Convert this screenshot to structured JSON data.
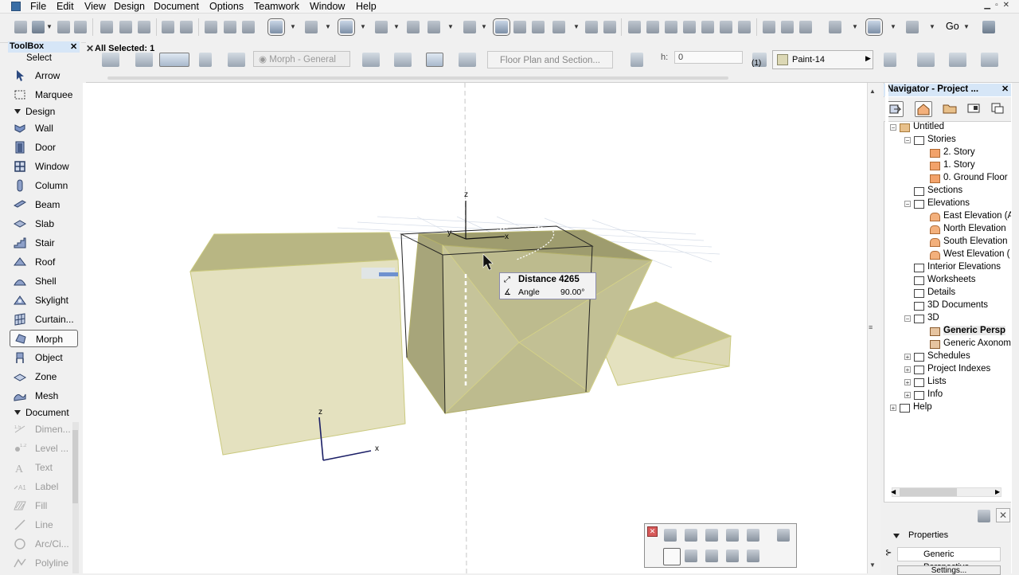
{
  "menubar": {
    "items": [
      "File",
      "Edit",
      "View",
      "Design",
      "Document",
      "Options",
      "Teamwork",
      "Window",
      "Help"
    ]
  },
  "toolbar": {
    "go_label": "Go"
  },
  "infobox": {
    "all_selected": "All Selected: 1",
    "morph_dropdown": "Morph - General",
    "floorplan_button": "Floor Plan and Section...",
    "height_label": "h:",
    "height_value": "0",
    "paint_label": "Paint-14",
    "paint_color": "#dcd8b5",
    "count_label": "(1)"
  },
  "toolbox": {
    "title": "ToolBox",
    "select_label": "Select",
    "select_tools": [
      {
        "label": "Arrow",
        "icon": "arrow-icon"
      },
      {
        "label": "Marquee",
        "icon": "marquee-icon"
      }
    ],
    "design_label": "Design",
    "design_tools": [
      {
        "label": "Wall",
        "icon": "wall-icon"
      },
      {
        "label": "Door",
        "icon": "door-icon"
      },
      {
        "label": "Window",
        "icon": "window-icon"
      },
      {
        "label": "Column",
        "icon": "column-icon"
      },
      {
        "label": "Beam",
        "icon": "beam-icon"
      },
      {
        "label": "Slab",
        "icon": "slab-icon"
      },
      {
        "label": "Stair",
        "icon": "stair-icon"
      },
      {
        "label": "Roof",
        "icon": "roof-icon"
      },
      {
        "label": "Shell",
        "icon": "shell-icon"
      },
      {
        "label": "Skylight",
        "icon": "skylight-icon"
      },
      {
        "label": "Curtain...",
        "icon": "curtain-wall-icon"
      },
      {
        "label": "Morph",
        "icon": "morph-icon",
        "selected": true
      },
      {
        "label": "Object",
        "icon": "object-icon"
      },
      {
        "label": "Zone",
        "icon": "zone-icon"
      },
      {
        "label": "Mesh",
        "icon": "mesh-icon"
      }
    ],
    "document_label": "Document",
    "document_tools": [
      {
        "label": "Dimen...",
        "icon": "dimension-icon"
      },
      {
        "label": "Level ...",
        "icon": "level-dimension-icon"
      },
      {
        "label": "Text",
        "icon": "text-icon"
      },
      {
        "label": "Label",
        "icon": "label-icon"
      },
      {
        "label": "Fill",
        "icon": "fill-icon"
      },
      {
        "label": "Line",
        "icon": "line-icon"
      },
      {
        "label": "Arc/Ci...",
        "icon": "arc-circle-icon"
      },
      {
        "label": "Polyline",
        "icon": "polyline-icon"
      }
    ]
  },
  "viewport": {
    "tooltip": {
      "distance_label": "Distance",
      "distance_value": "4265",
      "angle_label": "Angle",
      "angle_value": "90.00°"
    },
    "axes": {
      "z": "z",
      "y": "y",
      "x": "x"
    },
    "morph_color": "#d8d5a8"
  },
  "navigator": {
    "title": "Navigator - Project ...",
    "tree": [
      {
        "label": "Untitled",
        "level": 0,
        "icon": "folder"
      },
      {
        "label": "Stories",
        "level": 1,
        "icon": "doc"
      },
      {
        "label": "2. Story",
        "level": 2,
        "icon": "story"
      },
      {
        "label": "1. Story",
        "level": 2,
        "icon": "story"
      },
      {
        "label": "0. Ground Floor",
        "level": 2,
        "icon": "story"
      },
      {
        "label": "Sections",
        "level": 1,
        "icon": "doc"
      },
      {
        "label": "Elevations",
        "level": 1,
        "icon": "doc"
      },
      {
        "label": "East Elevation (A",
        "level": 2,
        "icon": "house"
      },
      {
        "label": "North Elevation",
        "level": 2,
        "icon": "house"
      },
      {
        "label": "South Elevation",
        "level": 2,
        "icon": "house"
      },
      {
        "label": "West Elevation (",
        "level": 2,
        "icon": "house"
      },
      {
        "label": "Interior Elevations",
        "level": 1,
        "icon": "doc"
      },
      {
        "label": "Worksheets",
        "level": 1,
        "icon": "doc"
      },
      {
        "label": "Details",
        "level": 1,
        "icon": "doc"
      },
      {
        "label": "3D Documents",
        "level": 1,
        "icon": "doc"
      },
      {
        "label": "3D",
        "level": 1,
        "icon": "doc"
      },
      {
        "label": "Generic Persp",
        "level": 2,
        "icon": "cube",
        "selected": true
      },
      {
        "label": "Generic Axonom",
        "level": 2,
        "icon": "cube"
      },
      {
        "label": "Schedules",
        "level": 1,
        "icon": "doc"
      },
      {
        "label": "Project Indexes",
        "level": 1,
        "icon": "doc"
      },
      {
        "label": "Lists",
        "level": 1,
        "icon": "doc"
      },
      {
        "label": "Info",
        "level": 1,
        "icon": "doc"
      },
      {
        "label": "Help",
        "level": 0,
        "icon": "doc"
      }
    ],
    "properties_label": "Properties",
    "properties_value": "Generic Perspective",
    "settings_label": "Settings..."
  }
}
